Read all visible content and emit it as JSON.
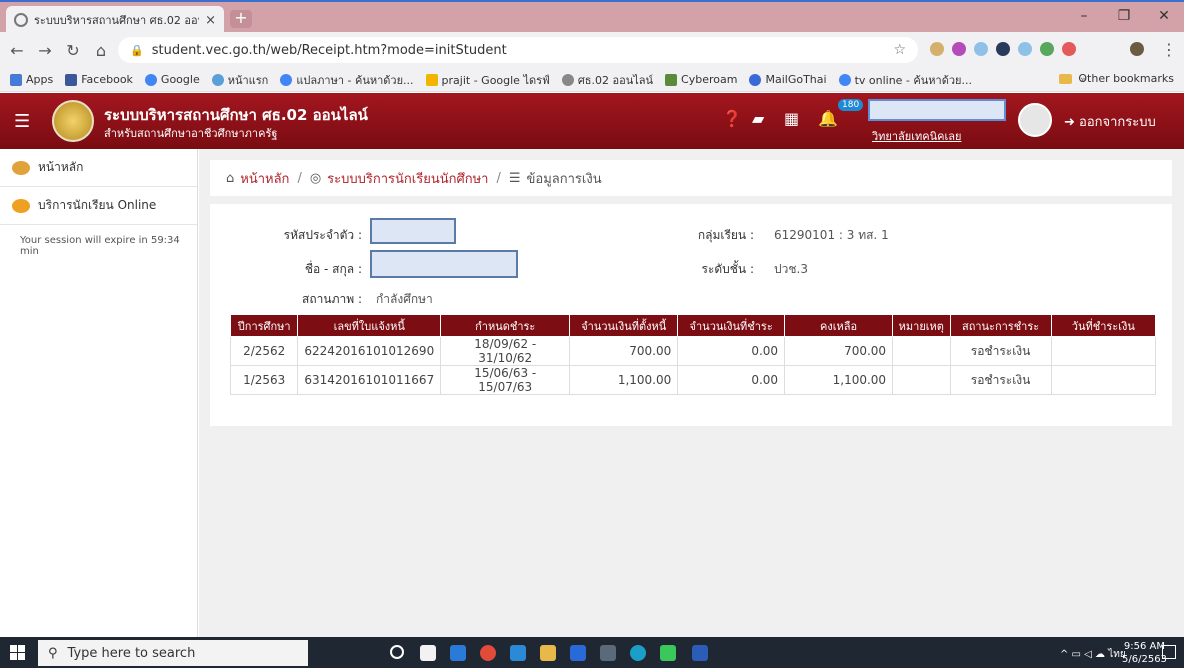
{
  "browser": {
    "tab_title": "ระบบบริหารสถานศึกษา ศธ.02 ออนไลน์",
    "tab_close": "×",
    "new_tab": "+",
    "url": "student.vec.go.th/web/Receipt.htm?mode=initStudent",
    "bookmarks": [
      "Apps",
      "Facebook",
      "Google",
      "หน้าแรก",
      "แปลภาษา - ค้นหาด้วย...",
      "prajit - Google ไดรฟ์",
      "ศธ.02 ออนไลน์",
      "Cyberoam",
      "MailGoThai",
      "tv online - ค้นหาด้วย..."
    ],
    "other_bookmarks": "Other bookmarks",
    "more": "»"
  },
  "header": {
    "title": "ระบบบริหารสถานศึกษา ศธ.02 ออนไลน์",
    "subtitle": "สำหรับสถานศึกษาอาชีวศึกษาภาครัฐ",
    "badge_count": "180",
    "college": "วิทยาลัยเทคนิคเลย",
    "logout": "ออกจากระบบ"
  },
  "sidebar": {
    "items": [
      {
        "label": "หน้าหลัก"
      },
      {
        "label": "บริการนักเรียน Online"
      }
    ],
    "session": "Your session will expire in 59:34 min"
  },
  "breadcrumb": {
    "home": "หน้าหลัก",
    "sep": "/",
    "service": "ระบบบริการนักเรียนนักศึกษา",
    "current": "ข้อมูลการเงิน"
  },
  "student": {
    "id_label": "รหัสประจำตัว :",
    "name_label": "ชื่อ - สกุล :",
    "status_label": "สถานภาพ :",
    "status_value": "กำลังศึกษา",
    "group_label": "กลุ่มเรียน :",
    "group_value": "61290101 : 3 ทส. 1",
    "level_label": "ระดับชั้น :",
    "level_value": "ปวช.3"
  },
  "table": {
    "headers": [
      "ปีการศึกษา",
      "เลขที่ใบแจ้งหนี้",
      "กำหนดชำระ",
      "จำนวนเงินที่ตั้งหนี้",
      "จำนวนเงินที่ชำระ",
      "คงเหลือ",
      "หมายเหตุ",
      "สถานะการชำระ",
      "วันที่ชำระเงิน"
    ],
    "rows": [
      {
        "year": "2/2562",
        "invoice": "62242016101012690",
        "due": "18/09/62 - 31/10/62",
        "amount": "700.00",
        "paid": "0.00",
        "balance": "700.00",
        "note": "",
        "status": "รอชำระเงิน",
        "paid_date": ""
      },
      {
        "year": "1/2563",
        "invoice": "63142016101011667",
        "due": "15/06/63 - 15/07/63",
        "amount": "1,100.00",
        "paid": "0.00",
        "balance": "1,100.00",
        "note": "",
        "status": "รอชำระเงิน",
        "paid_date": ""
      }
    ]
  },
  "taskbar": {
    "search_placeholder": "Type here to search",
    "lang": "ไทย",
    "time": "9:56 AM",
    "date": "5/6/2563"
  },
  "colors": {
    "header": "#8f1119",
    "table_header": "#7b0d13",
    "link": "#1e6bb8"
  }
}
